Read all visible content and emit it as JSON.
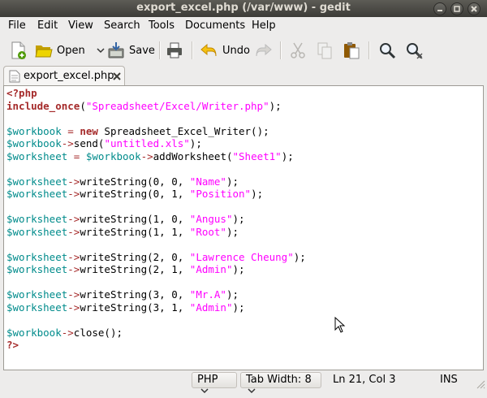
{
  "window": {
    "title": "export_excel.php (/var/www) - gedit"
  },
  "menubar": {
    "items": [
      "File",
      "Edit",
      "View",
      "Search",
      "Tools",
      "Documents",
      "Help"
    ]
  },
  "toolbar": {
    "open_label": "Open",
    "save_label": "Save",
    "undo_label": "Undo"
  },
  "tab": {
    "label": "export_excel.php"
  },
  "editor": {
    "lines": [
      [
        [
          "kw",
          "<?php"
        ]
      ],
      [
        [
          "kw",
          "include_once"
        ],
        [
          "plain",
          "("
        ],
        [
          "str",
          "\"Spreadsheet/Excel/Writer.php\""
        ],
        [
          "plain",
          ");"
        ]
      ],
      [],
      [
        [
          "var",
          "$workbook"
        ],
        [
          "plain",
          " "
        ],
        [
          "op",
          "="
        ],
        [
          "plain",
          " "
        ],
        [
          "kw",
          "new"
        ],
        [
          "plain",
          " Spreadsheet_Excel_Writer();"
        ]
      ],
      [
        [
          "var",
          "$workbook"
        ],
        [
          "op",
          "->"
        ],
        [
          "plain",
          "send("
        ],
        [
          "str",
          "\"untitled.xls\""
        ],
        [
          "plain",
          ");"
        ]
      ],
      [
        [
          "var",
          "$worksheet"
        ],
        [
          "plain",
          " "
        ],
        [
          "op",
          "="
        ],
        [
          "plain",
          " "
        ],
        [
          "var",
          "$workbook"
        ],
        [
          "op",
          "->"
        ],
        [
          "plain",
          "addWorksheet("
        ],
        [
          "str",
          "\"Sheet1\""
        ],
        [
          "plain",
          ");"
        ]
      ],
      [],
      [
        [
          "var",
          "$worksheet"
        ],
        [
          "op",
          "->"
        ],
        [
          "plain",
          "writeString(0, 0, "
        ],
        [
          "str",
          "\"Name\""
        ],
        [
          "plain",
          ");"
        ]
      ],
      [
        [
          "var",
          "$worksheet"
        ],
        [
          "op",
          "->"
        ],
        [
          "plain",
          "writeString(0, 1, "
        ],
        [
          "str",
          "\"Position\""
        ],
        [
          "plain",
          ");"
        ]
      ],
      [],
      [
        [
          "var",
          "$worksheet"
        ],
        [
          "op",
          "->"
        ],
        [
          "plain",
          "writeString(1, 0, "
        ],
        [
          "str",
          "\"Angus\""
        ],
        [
          "plain",
          ");"
        ]
      ],
      [
        [
          "var",
          "$worksheet"
        ],
        [
          "op",
          "->"
        ],
        [
          "plain",
          "writeString(1, 1, "
        ],
        [
          "str",
          "\"Root\""
        ],
        [
          "plain",
          ");"
        ]
      ],
      [],
      [
        [
          "var",
          "$worksheet"
        ],
        [
          "op",
          "->"
        ],
        [
          "plain",
          "writeString(2, 0, "
        ],
        [
          "str",
          "\"Lawrence Cheung\""
        ],
        [
          "plain",
          ");"
        ]
      ],
      [
        [
          "var",
          "$worksheet"
        ],
        [
          "op",
          "->"
        ],
        [
          "plain",
          "writeString(2, 1, "
        ],
        [
          "str",
          "\"Admin\""
        ],
        [
          "plain",
          ");"
        ]
      ],
      [],
      [
        [
          "var",
          "$worksheet"
        ],
        [
          "op",
          "->"
        ],
        [
          "plain",
          "writeString(3, 0, "
        ],
        [
          "str",
          "\"Mr.A\""
        ],
        [
          "plain",
          ");"
        ]
      ],
      [
        [
          "var",
          "$worksheet"
        ],
        [
          "op",
          "->"
        ],
        [
          "plain",
          "writeString(3, 1, "
        ],
        [
          "str",
          "\"Admin\""
        ],
        [
          "plain",
          ");"
        ]
      ],
      [],
      [
        [
          "var",
          "$workbook"
        ],
        [
          "op",
          "->"
        ],
        [
          "plain",
          "close();"
        ]
      ],
      [
        [
          "kw",
          "?>"
        ]
      ]
    ]
  },
  "statusbar": {
    "language": "PHP",
    "tab_width_label": "Tab Width:",
    "tab_width_value": "8",
    "position": "Ln 21, Col 3",
    "mode": "INS"
  },
  "colors": {
    "keyword": "#a52a2a",
    "variable": "#008b8b",
    "string": "#ff00ff"
  }
}
